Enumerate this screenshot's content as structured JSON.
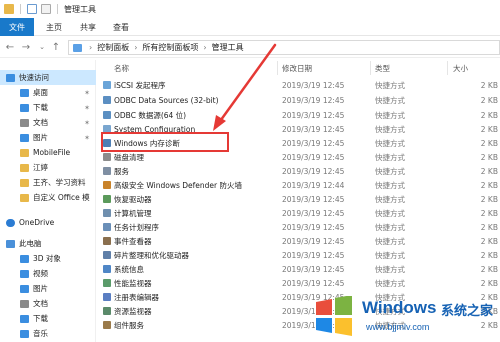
{
  "window": {
    "title": "管理工具"
  },
  "ribbon": {
    "tabs": [
      "文件",
      "主页",
      "共享",
      "查看"
    ]
  },
  "address": {
    "crumbs": [
      "控制面板",
      "所有控制面板项",
      "管理工具"
    ]
  },
  "columns": {
    "name": "名称",
    "date": "修改日期",
    "type": "类型",
    "size": "大小"
  },
  "sidebar": {
    "items": [
      {
        "label": "快速访问",
        "color": "#3b8ee0",
        "pinned": false
      },
      {
        "label": "桌面",
        "color": "#3b8ee0",
        "pinned": true
      },
      {
        "label": "下载",
        "color": "#3b8ee0",
        "pinned": true
      },
      {
        "label": "文档",
        "color": "#8a8a8a",
        "pinned": true
      },
      {
        "label": "图片",
        "color": "#3b8ee0",
        "pinned": true
      },
      {
        "label": "MobileFile",
        "color": "#e8b84a",
        "pinned": false
      },
      {
        "label": "江婷",
        "color": "#e8b84a",
        "pinned": false
      },
      {
        "label": "王齐、学习资料",
        "color": "#e8b84a",
        "pinned": false
      },
      {
        "label": "自定义 Office 模",
        "color": "#e8b84a",
        "pinned": false
      },
      {
        "label": "OneDrive",
        "color": "#2b7cd3",
        "pinned": false
      },
      {
        "label": "此电脑",
        "color": "#4a90d9",
        "pinned": false
      },
      {
        "label": "3D 对象",
        "color": "#3b8ee0",
        "pinned": false
      },
      {
        "label": "视频",
        "color": "#3b8ee0",
        "pinned": false
      },
      {
        "label": "图片",
        "color": "#3b8ee0",
        "pinned": false
      },
      {
        "label": "文档",
        "color": "#8a8a8a",
        "pinned": false
      },
      {
        "label": "下载",
        "color": "#3b8ee0",
        "pinned": false
      },
      {
        "label": "音乐",
        "color": "#3b8ee0",
        "pinned": false
      }
    ]
  },
  "files": [
    {
      "name": "iSCSI 发起程序",
      "date": "2019/3/19 12:45",
      "type": "快捷方式",
      "size": "2 KB",
      "color": "#6aa4d8"
    },
    {
      "name": "ODBC Data Sources (32-bit)",
      "date": "2019/3/19 12:45",
      "type": "快捷方式",
      "size": "2 KB",
      "color": "#5b8fc2"
    },
    {
      "name": "ODBC 数据源(64 位)",
      "date": "2019/3/19 12:45",
      "type": "快捷方式",
      "size": "2 KB",
      "color": "#5b8fc2"
    },
    {
      "name": "System Configuration",
      "date": "2019/3/19 12:45",
      "type": "快捷方式",
      "size": "2 KB",
      "color": "#7aa6cf"
    },
    {
      "name": "Windows 内存诊断",
      "date": "2019/3/19 12:45",
      "type": "快捷方式",
      "size": "2 KB",
      "color": "#4e7fb5"
    },
    {
      "name": "磁盘清理",
      "date": "2019/3/19 12:45",
      "type": "快捷方式",
      "size": "2 KB",
      "color": "#8c8c8c"
    },
    {
      "name": "服务",
      "date": "2019/3/19 12:45",
      "type": "快捷方式",
      "size": "2 KB",
      "color": "#7f8fa3"
    },
    {
      "name": "高级安全 Windows Defender 防火墙",
      "date": "2019/3/19 12:44",
      "type": "快捷方式",
      "size": "2 KB",
      "color": "#c9832a"
    },
    {
      "name": "恢复驱动器",
      "date": "2019/3/19 12:45",
      "type": "快捷方式",
      "size": "2 KB",
      "color": "#5b9a5b"
    },
    {
      "name": "计算机管理",
      "date": "2019/3/19 12:45",
      "type": "快捷方式",
      "size": "2 KB",
      "color": "#6f8fae"
    },
    {
      "name": "任务计划程序",
      "date": "2019/3/19 12:45",
      "type": "快捷方式",
      "size": "2 KB",
      "color": "#6a8fb8"
    },
    {
      "name": "事件查看器",
      "date": "2019/3/19 12:45",
      "type": "快捷方式",
      "size": "2 KB",
      "color": "#8a6f4e"
    },
    {
      "name": "碎片整理和优化驱动器",
      "date": "2019/3/19 12:45",
      "type": "快捷方式",
      "size": "2 KB",
      "color": "#5f7fa8"
    },
    {
      "name": "系统信息",
      "date": "2019/3/19 12:45",
      "type": "快捷方式",
      "size": "2 KB",
      "color": "#4f86c6"
    },
    {
      "name": "性能监视器",
      "date": "2019/3/19 12:45",
      "type": "快捷方式",
      "size": "2 KB",
      "color": "#5a9b6a"
    },
    {
      "name": "注册表编辑器",
      "date": "2019/3/19 12:45",
      "type": "快捷方式",
      "size": "2 KB",
      "color": "#5a7ec2"
    },
    {
      "name": "资源监视器",
      "date": "2019/3/19 12:45",
      "type": "快捷方式",
      "size": "2 KB",
      "color": "#5a8a6a"
    },
    {
      "name": "组件服务",
      "date": "2019/3/19 12:45",
      "type": "快捷方式",
      "size": "2 KB",
      "color": "#9a7a4a"
    }
  ],
  "watermark": {
    "brand": "Windows",
    "tagline": "系统之家",
    "url": "www.bjjmlv.com"
  }
}
